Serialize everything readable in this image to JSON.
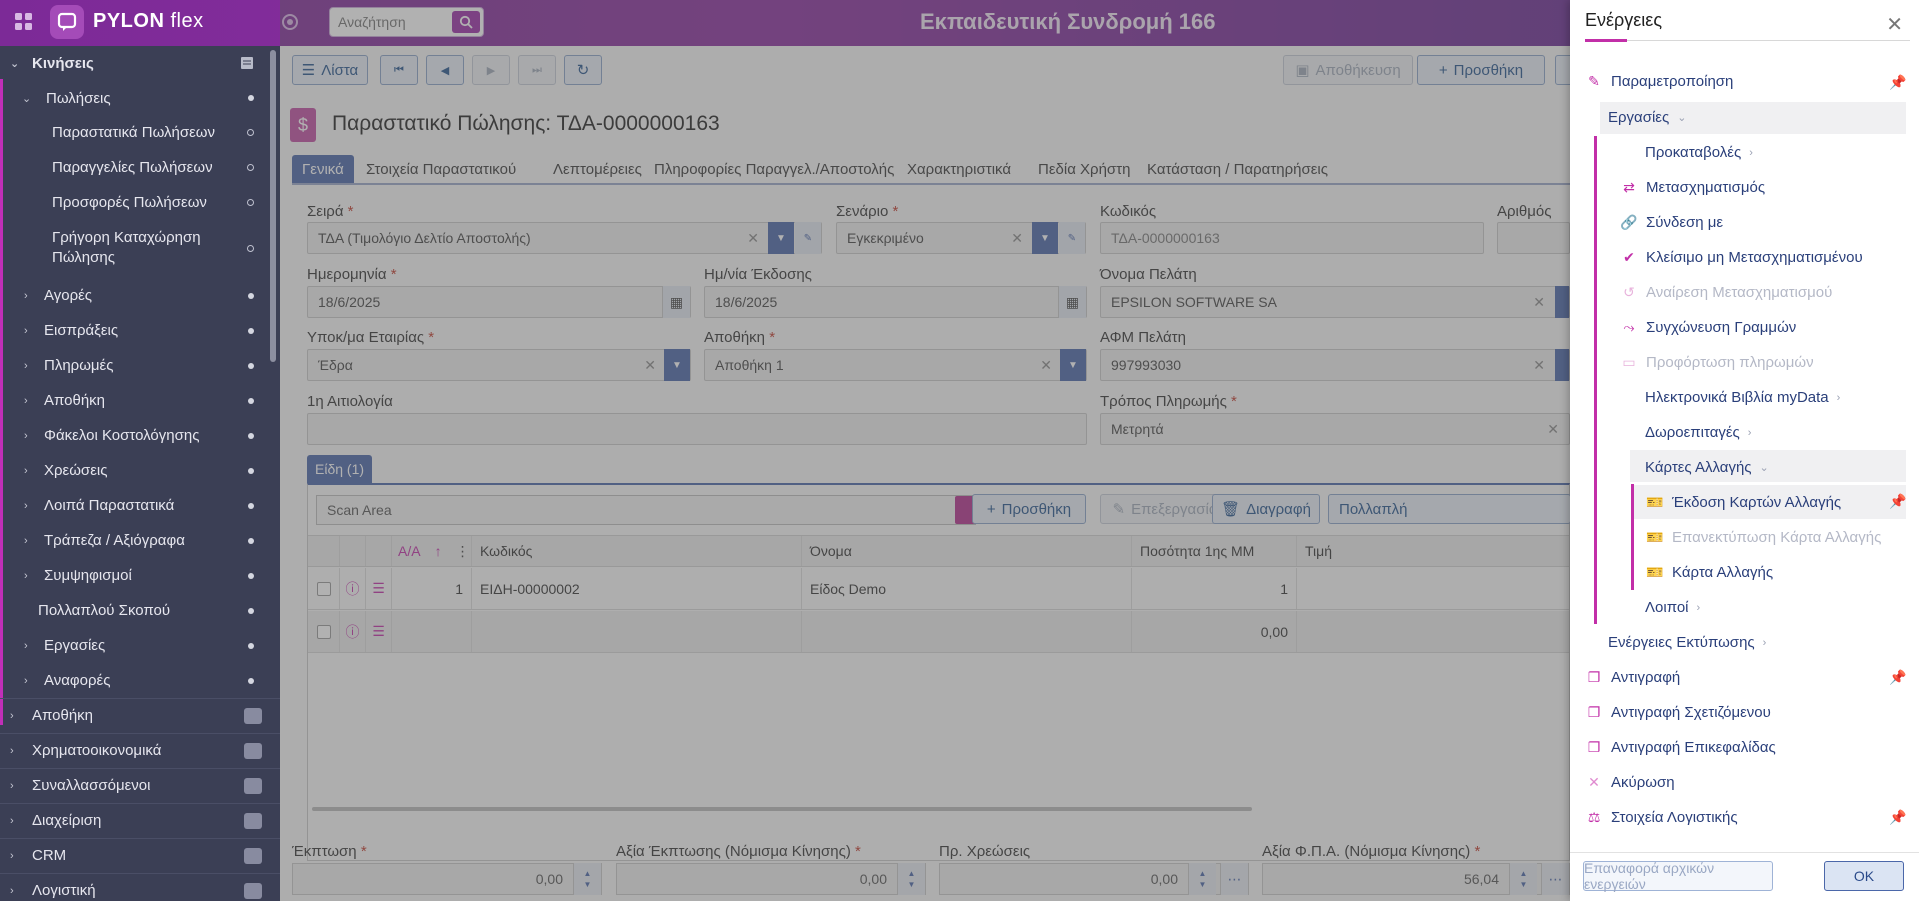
{
  "topbar": {
    "logo_brand": "PYLON",
    "logo_suffix": " flex",
    "search_placeholder": "Αναζήτηση",
    "title": "Εκπαιδευτική Συνδρομή 166"
  },
  "sidebar": {
    "items": [
      {
        "label": "Κινήσεις"
      },
      {
        "label": "Πωλήσεις"
      },
      {
        "label": "Παραστατικά Πωλήσεων"
      },
      {
        "label": "Παραγγελίες Πωλήσεων"
      },
      {
        "label": "Προσφορές Πωλήσεων"
      },
      {
        "label": "Γρήγορη Καταχώρηση Πώλησης"
      },
      {
        "label": "Αγορές"
      },
      {
        "label": "Εισπράξεις"
      },
      {
        "label": "Πληρωμές"
      },
      {
        "label": "Αποθήκη"
      },
      {
        "label": "Φάκελοι Κοστολόγησης"
      },
      {
        "label": "Χρεώσεις"
      },
      {
        "label": "Λοιπά Παραστατικά"
      },
      {
        "label": "Τράπεζα / Αξιόγραφα"
      },
      {
        "label": "Συμψηφισμοί"
      },
      {
        "label": "Πολλαπλού Σκοπού"
      },
      {
        "label": "Εργασίες"
      },
      {
        "label": "Αναφορές"
      }
    ],
    "sections": [
      {
        "label": "Αποθήκη"
      },
      {
        "label": "Χρηματοοικονομικά"
      },
      {
        "label": "Συναλλασσόμενοι"
      },
      {
        "label": "Διαχείριση"
      },
      {
        "label": "CRM"
      },
      {
        "label": "Λογιστική"
      }
    ]
  },
  "toolbar": {
    "list_label": "Λίστα",
    "save_label": "Αποθήκευση",
    "add_label": "Προσθήκη"
  },
  "document": {
    "title": "Παραστατικό Πώλησης: ΤΔΑ-0000000163",
    "tabs": [
      {
        "label": "Γενικά"
      },
      {
        "label": "Στοιχεία Παραστατικού"
      },
      {
        "label": "Λεπτομέρειες"
      },
      {
        "label": "Πληροφορίες Παραγγελ./Αποστολής"
      },
      {
        "label": "Χαρακτηριστικά"
      },
      {
        "label": "Πεδία Χρήστη"
      },
      {
        "label": "Κατάσταση / Παρατηρήσεις"
      }
    ]
  },
  "form": {
    "series_label": "Σειρά",
    "series_value": "ΤΔΑ (Τιμολόγιο Δελτίο Αποστολής)",
    "scenario_label": "Σενάριο",
    "scenario_value": "Εγκεκριμένο",
    "code_label": "Κωδικός",
    "code_value": "ΤΔΑ-0000000163",
    "number_label": "Αριθμός",
    "date_label": "Ημερομηνία",
    "date_value": "18/6/2025",
    "issue_date_label": "Ημ/νία Έκδοσης",
    "issue_date_value": "18/6/2025",
    "customer_label": "Όνομα Πελάτη",
    "customer_value": "EPSILON SOFTWARE SA",
    "branch_label": "Υποκ/μα Εταιρίας",
    "branch_value": "Έδρα",
    "warehouse_label": "Αποθήκη",
    "warehouse_value": "Αποθήκη 1",
    "vat_label": "ΑΦΜ Πελάτη",
    "vat_value": "997993030",
    "reason_label": "1η Αιτιολογία",
    "reason_value": "",
    "payment_label": "Τρόπος Πληρωμής",
    "payment_value": "Μετρητά",
    "required_mark": "*"
  },
  "items": {
    "section_tab": "Είδη (1)",
    "scan_placeholder": "Scan Area",
    "add_label": "Προσθήκη",
    "edit_label": "Επεξεργασία",
    "delete_label": "Διαγραφή",
    "multi_label": "Πολλαπλή",
    "columns": [
      "Α/Α",
      "Κωδικός",
      "Όνομα",
      "Ποσότητα 1ης ΜΜ",
      "Τιμή"
    ],
    "rows": [
      {
        "aa": "1",
        "code": "ΕΙΔΗ-00000002",
        "name": "Είδος Demo",
        "qty": "1"
      },
      {
        "aa": "",
        "code": "",
        "name": "",
        "qty": "0,00"
      }
    ]
  },
  "totals": {
    "discount_label": "Έκπτωση",
    "discount_value": "0,00",
    "discount_amount_label": "Αξία Έκπτωσης (Νόμισμα Κίνησης)",
    "discount_amount_value": "0,00",
    "charges_label": "Πρ. Χρεώσεις",
    "charges_value": "0,00",
    "vat_amount_label": "Αξία Φ.Π.Α. (Νόμισμα Κίνησης)",
    "vat_amount_value": "56,04"
  },
  "panel": {
    "title": "Ενέργειες",
    "actions": [
      {
        "label": "Παραμετροποίηση"
      },
      {
        "label": "Εργασίες"
      },
      {
        "label": "Προκαταβολές"
      },
      {
        "label": "Μετασχηματισμός"
      },
      {
        "label": "Σύνδεση με"
      },
      {
        "label": "Κλείσιμο μη Μετασχηματισμένου"
      },
      {
        "label": "Αναίρεση Μετασχηματισμού"
      },
      {
        "label": "Συγχώνευση Γραμμών"
      },
      {
        "label": "Προφόρτωση πληρωμών"
      },
      {
        "label": "Ηλεκτρονικά Βιβλία myData"
      },
      {
        "label": "Δωροεπιταγές"
      },
      {
        "label": "Κάρτες Αλλαγής"
      },
      {
        "label": "Έκδοση Καρτών Αλλαγής"
      },
      {
        "label": "Επανεκτύπωση Κάρτα Αλλαγής"
      },
      {
        "label": "Κάρτα Αλλαγής"
      },
      {
        "label": "Λοιποί"
      },
      {
        "label": "Ενέργειες Εκτύπωσης"
      },
      {
        "label": "Αντιγραφή"
      },
      {
        "label": "Αντιγραφή Σχετιζόμενου"
      },
      {
        "label": "Αντιγραφή Επικεφαλίδας"
      },
      {
        "label": "Ακύρωση"
      },
      {
        "label": "Στοιχεία Λογιστικής"
      }
    ],
    "reset_label": "Επαναφορά αρχικών ενεργειών",
    "ok_label": "OK"
  },
  "colors": {
    "brand": "#8b2f9f",
    "accent": "#c22fa8",
    "primary": "#4b67a9",
    "sidebar": "#3b3f55"
  }
}
